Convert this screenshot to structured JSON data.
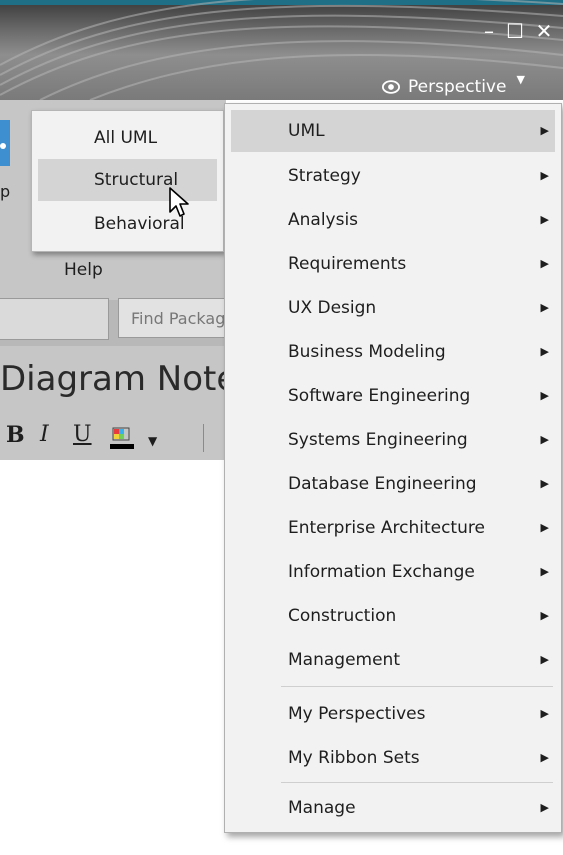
{
  "window": {
    "minimize_icon": "minimize-icon",
    "maximize_icon": "maximize-icon",
    "close_icon": "close-icon",
    "accent_color": "#1f6f86"
  },
  "perspective_button": {
    "label": "Perspective",
    "icon": "eye-icon"
  },
  "app": {
    "ribbon_partial_text": "p",
    "help_label": "Help",
    "find_placeholder": "Find Package",
    "diagram_note_label": "Diagram Notes",
    "format": {
      "bold": "B",
      "italic": "I",
      "underline": "U"
    }
  },
  "submenu": {
    "items": [
      {
        "label": "All UML"
      },
      {
        "label": "Structural",
        "hovered": true
      },
      {
        "label": "Behavioral"
      }
    ]
  },
  "menu": {
    "items": [
      {
        "label": "UML",
        "hovered": true
      },
      {
        "label": "Strategy"
      },
      {
        "label": "Analysis"
      },
      {
        "label": "Requirements"
      },
      {
        "label": "UX Design"
      },
      {
        "label": "Business Modeling"
      },
      {
        "label": "Software Engineering"
      },
      {
        "label": "Systems Engineering"
      },
      {
        "label": "Database Engineering"
      },
      {
        "label": "Enterprise Architecture"
      },
      {
        "label": "Information Exchange"
      },
      {
        "label": "Construction"
      },
      {
        "label": "Management"
      },
      {
        "label": "My Perspectives"
      },
      {
        "label": "My Ribbon Sets"
      },
      {
        "label": "Manage"
      }
    ],
    "hover_color": "#d4d4d4",
    "background_color": "#f2f2f2"
  }
}
